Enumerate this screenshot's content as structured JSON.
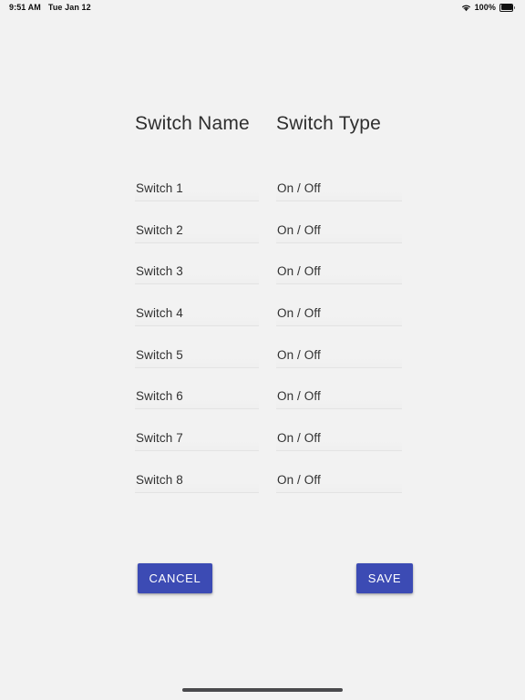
{
  "status_bar": {
    "time": "9:51 AM",
    "date": "Tue Jan 12",
    "battery_percent": "100%",
    "wifi_icon": "wifi-icon",
    "battery_icon": "battery-full-icon"
  },
  "table": {
    "headers": {
      "name": "Switch Name",
      "type": "Switch Type"
    },
    "rows": [
      {
        "name": "Switch 1",
        "type": "On / Off"
      },
      {
        "name": "Switch 2",
        "type": "On / Off"
      },
      {
        "name": "Switch 3",
        "type": "On / Off"
      },
      {
        "name": "Switch 4",
        "type": "On / Off"
      },
      {
        "name": "Switch 5",
        "type": "On / Off"
      },
      {
        "name": "Switch 6",
        "type": "On / Off"
      },
      {
        "name": "Switch 7",
        "type": "On / Off"
      },
      {
        "name": "Switch 8",
        "type": "On / Off"
      }
    ]
  },
  "actions": {
    "cancel_label": "CANCEL",
    "save_label": "SAVE"
  },
  "colors": {
    "background": "#f2f2f2",
    "button": "#3c4bb4",
    "button_text": "#ffffff",
    "text": "#313131",
    "header_text": "#2f2f2f",
    "field_underline": "#e3e3e3",
    "home_indicator": "#4a4a4d"
  }
}
